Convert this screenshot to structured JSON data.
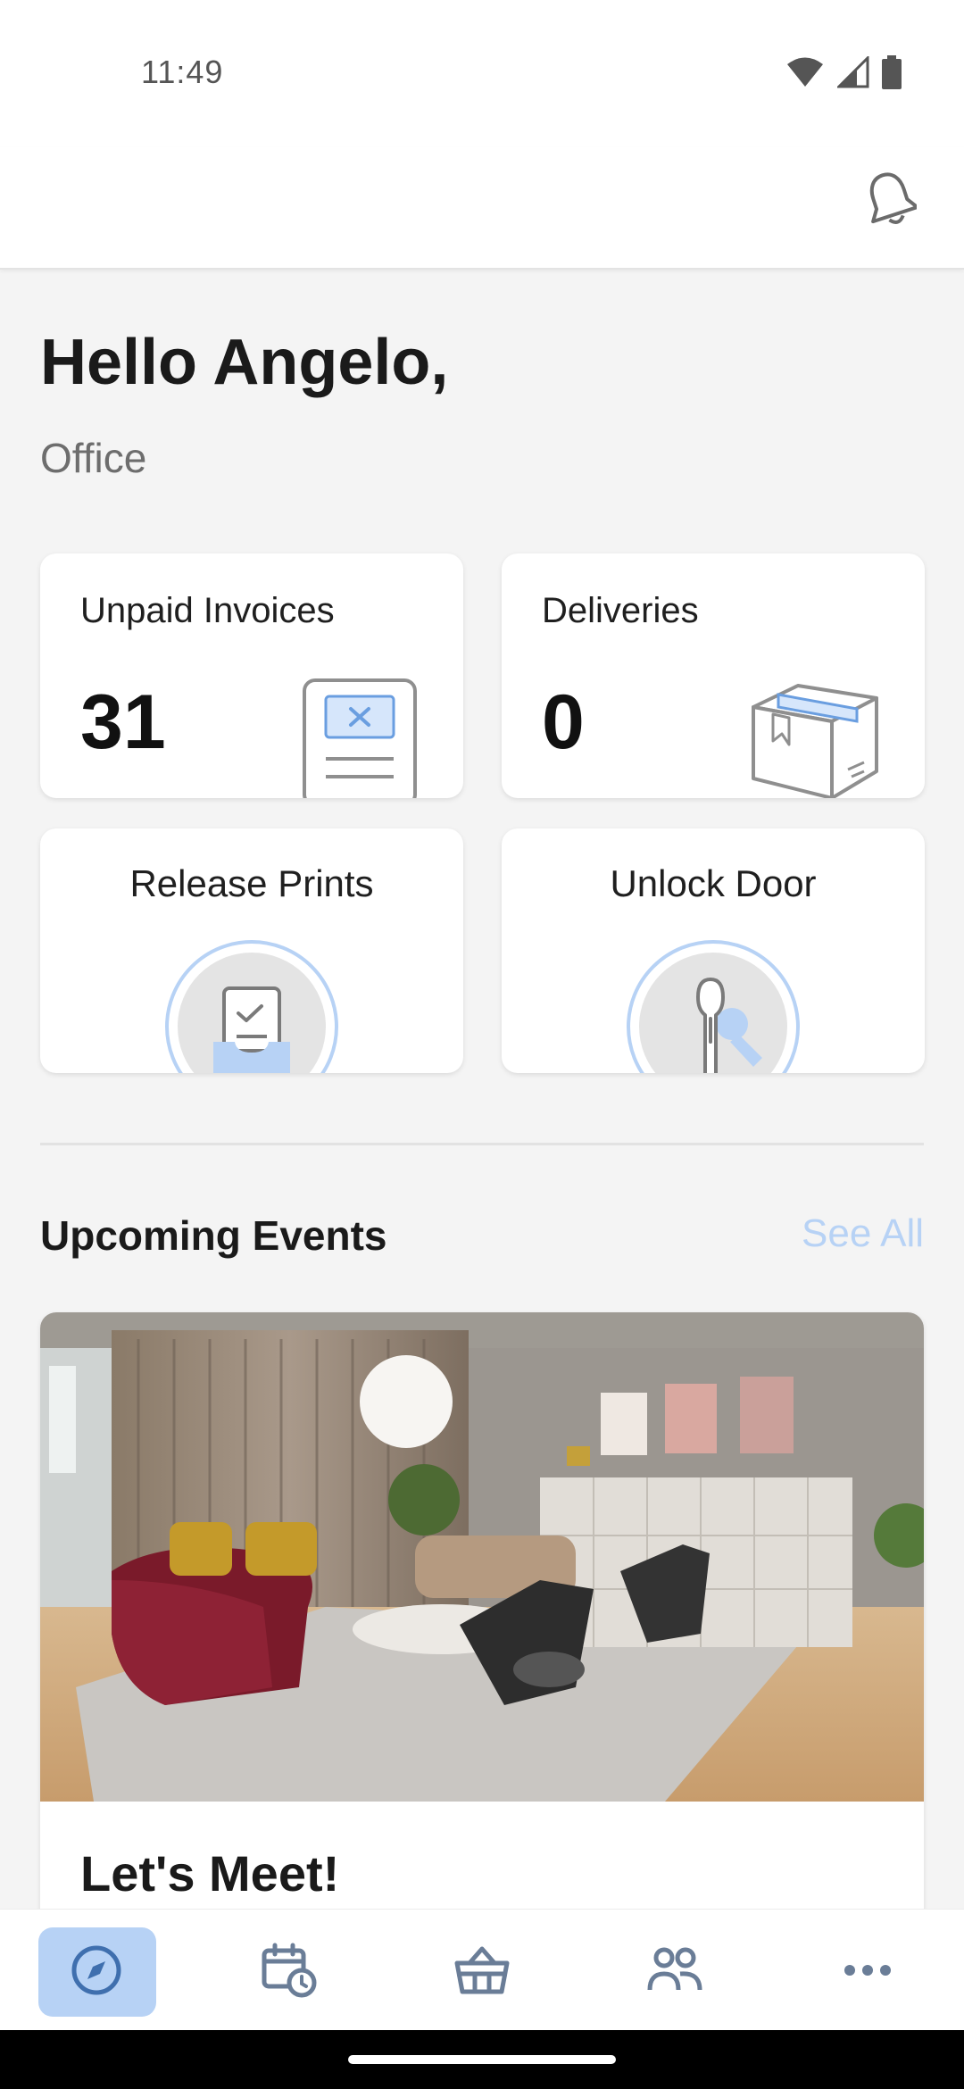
{
  "status_bar": {
    "time": "11:49",
    "icons": [
      "wifi-icon",
      "cellular-signal-icon",
      "battery-icon"
    ]
  },
  "app_bar": {
    "icon": "bell-icon"
  },
  "greeting": {
    "title": "Hello Angelo,",
    "subtitle": "Office"
  },
  "cards": {
    "unpaid_invoices": {
      "label": "Unpaid Invoices",
      "value": "31",
      "icon": "invoice-icon"
    },
    "deliveries": {
      "label": "Deliveries",
      "value": "0",
      "icon": "package-icon"
    },
    "release_prints": {
      "label": "Release Prints",
      "icon": "printer-tray-icon"
    },
    "unlock_door": {
      "label": "Unlock Door",
      "icon": "key-icon"
    }
  },
  "events_section": {
    "title": "Upcoming Events",
    "see_all_label": "See All",
    "event": {
      "title": "Let's Meet!",
      "image": "office-lounge-photo"
    }
  },
  "bottom_nav": {
    "items": [
      {
        "name": "explore",
        "icon": "compass-icon",
        "active": true
      },
      {
        "name": "bookings",
        "icon": "calendar-clock-icon",
        "active": false
      },
      {
        "name": "shop",
        "icon": "basket-icon",
        "active": false
      },
      {
        "name": "community",
        "icon": "people-icon",
        "active": false
      },
      {
        "name": "more",
        "icon": "more-icon",
        "active": false
      }
    ]
  },
  "colors": {
    "accent": "#b7d2f5",
    "background": "#f4f4f4",
    "card": "#ffffff",
    "icon_blue": "#3f6fae"
  }
}
